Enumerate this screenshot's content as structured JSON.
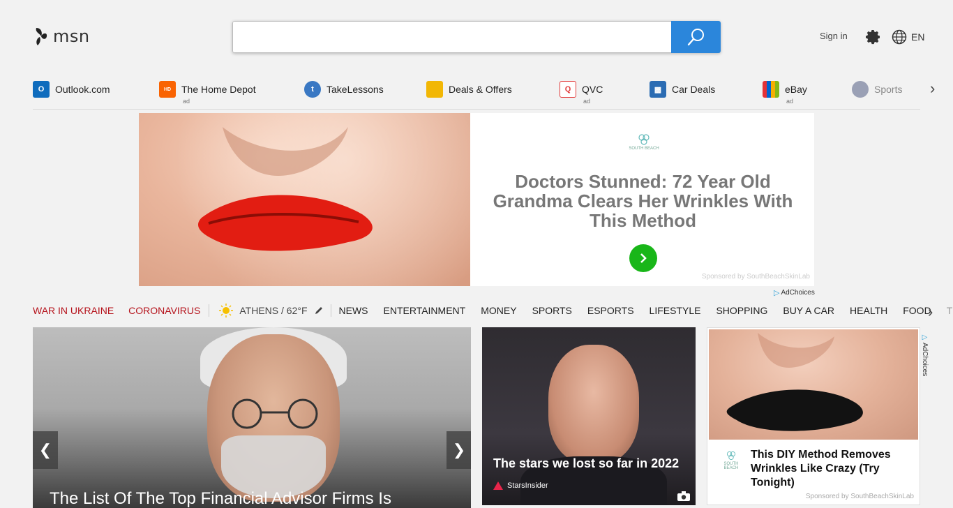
{
  "header": {
    "logo_text": "msn",
    "search": {
      "value": "",
      "placeholder": ""
    },
    "signin_label": "Sign in",
    "lang_label": "EN"
  },
  "quick_links": [
    {
      "label": "Outlook.com",
      "ad": "",
      "icon": "outlook-icon",
      "color": "#0f6cbd"
    },
    {
      "label": "The Home Depot",
      "ad": "ad",
      "icon": "home-depot-icon",
      "color": "#f96302"
    },
    {
      "label": "TakeLessons",
      "ad": "",
      "icon": "takelessons-icon",
      "color": "#3a78c3"
    },
    {
      "label": "Deals & Offers",
      "ad": "",
      "icon": "deals-tag-icon",
      "color": "#f2b705"
    },
    {
      "label": "QVC",
      "ad": "ad",
      "icon": "qvc-icon",
      "color": "#e23b3b"
    },
    {
      "label": "Car Deals",
      "ad": "",
      "icon": "car-icon",
      "color": "#2b6cb3"
    },
    {
      "label": "eBay",
      "ad": "ad",
      "icon": "ebay-bag-icon",
      "color": "#222222"
    },
    {
      "label": "Sports",
      "ad": "",
      "icon": "sports-icon",
      "color": "#9aa0b5"
    }
  ],
  "banner_ad": {
    "brand": "SOUTH BEACH",
    "headline": "Doctors Stunned: 72 Year Old Grandma Clears Her Wrinkles With This Method",
    "sponsor": "Sponsored by SouthBeachSkinLab",
    "adchoices": "AdChoices"
  },
  "nav": {
    "war": "WAR IN UKRAINE",
    "corona": "CORONAVIRUS",
    "weather": "ATHENS / 62°F",
    "items": [
      "NEWS",
      "ENTERTAINMENT",
      "MONEY",
      "SPORTS",
      "ESPORTS",
      "LIFESTYLE",
      "SHOPPING",
      "BUY A CAR",
      "HEALTH",
      "FOOD",
      "TRAVEL"
    ]
  },
  "hero": {
    "title": "The List Of The Top Financial Advisor Firms Is"
  },
  "card2": {
    "title": "The stars we lost so far in 2022",
    "source": "StarsInsider"
  },
  "ad2": {
    "brand": "SOUTH BEACH",
    "headline": "This DIY Method Removes Wrinkles Like Crazy (Try Tonight)",
    "sponsor": "Sponsored by SouthBeachSkinLab",
    "adchoices": "AdChoices"
  }
}
